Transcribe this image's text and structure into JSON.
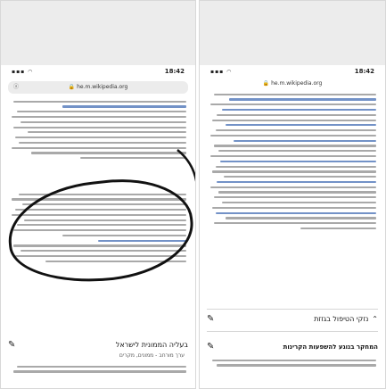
{
  "left_phone": {
    "status_time": "18:42",
    "url": "he.m.wikipedia.org",
    "section_title": "בעליה הממונית לישראל",
    "section_sub": "ערך מורחב - ממונים, מקרים"
  },
  "right_phone": {
    "status_time": "18:42",
    "url": "he.m.wikipedia.org",
    "section_title_1": "נזקי הטיפול בגזזת",
    "section_title_2": "המחקר בנוגע להשפעות הקרינות"
  },
  "icons": {
    "lock": "lock-icon",
    "pen": "pencil-icon",
    "chevron": "chevron-up-icon"
  },
  "colors": {
    "link": "#5b7fbd",
    "text": "#9a9a9a",
    "ink": "#111111"
  }
}
